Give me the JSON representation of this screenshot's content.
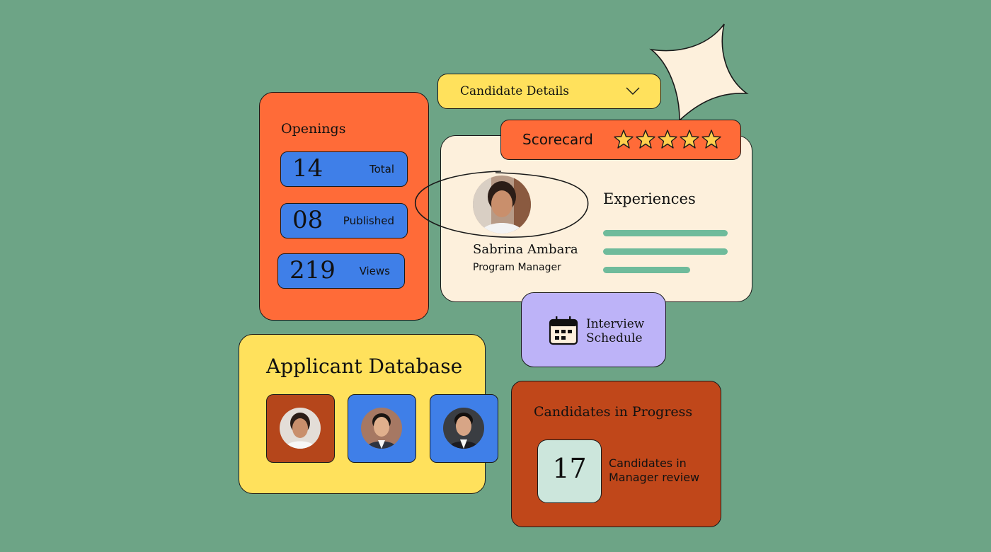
{
  "colors": {
    "background": "#6da486",
    "orange": "#ff6b38",
    "blue": "#3f7fe8",
    "yellow": "#ffe15c",
    "cream": "#fdf0dc",
    "lavender": "#bdb3f8",
    "rust": "#c0471a",
    "mint": "#cce6dc",
    "green_bar": "#6fbb9b",
    "star": "#ffcf4d"
  },
  "openings": {
    "title": "Openings",
    "stats": [
      {
        "value": "14",
        "label": "Total"
      },
      {
        "value": "08",
        "label": "Published"
      },
      {
        "value": "219",
        "label": "Views"
      }
    ]
  },
  "candidate_dropdown": {
    "selected": "Candidate Details",
    "icon": "chevron-down-icon"
  },
  "scorecard": {
    "label": "Scorecard",
    "rating": 5,
    "max_rating": 5
  },
  "profile": {
    "name": "Sabrina Ambara",
    "role": "Program Manager",
    "experiences_title": "Experiences",
    "experience_bars": [
      1.0,
      1.0,
      0.7
    ]
  },
  "interview": {
    "line1": "Interview",
    "line2": "Schedule",
    "icon": "calendar-icon"
  },
  "applicants": {
    "title": "Applicant Database",
    "tiles": [
      {
        "name": "applicant-1",
        "color": "#b5461b"
      },
      {
        "name": "applicant-2",
        "color": "#3f7fe8"
      },
      {
        "name": "applicant-3",
        "color": "#3f7fe8"
      }
    ]
  },
  "candidates_progress": {
    "title": "Candidates in Progress",
    "count": "17",
    "desc_line1": "Candidates in",
    "desc_line2": "Manager review"
  }
}
